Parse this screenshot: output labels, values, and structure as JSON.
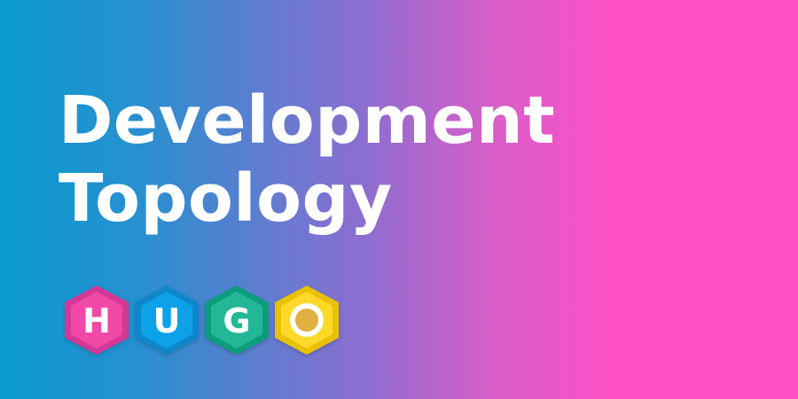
{
  "banner": {
    "title_line1": "Development",
    "title_line2": "Topology"
  },
  "logo": {
    "letters": [
      "H",
      "U",
      "G",
      "O"
    ],
    "colors": {
      "h_outer": "#d33794",
      "h_inner": "#f24aa8",
      "u_outer": "#0a87c9",
      "u_inner": "#11a2e8",
      "g_outer": "#109c7b",
      "g_inner": "#22b897",
      "o_outer": "#e9c100",
      "o_inner": "#ffd92a",
      "o_circle": "#e1b03f"
    },
    "icons": [
      "h-letter-hexagon-icon",
      "u-letter-hexagon-icon",
      "g-letter-hexagon-icon",
      "o-circle-hexagon-icon"
    ]
  }
}
